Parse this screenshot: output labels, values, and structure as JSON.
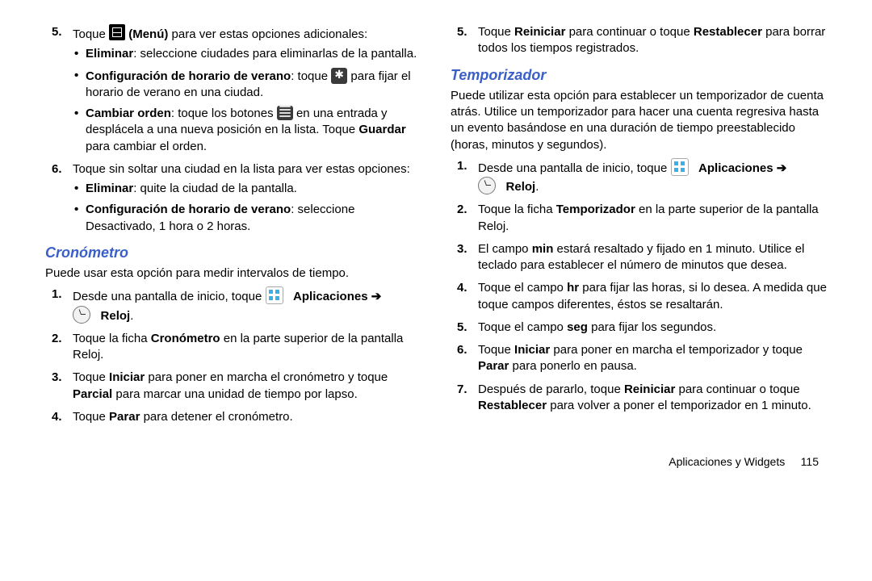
{
  "left": {
    "steps_a": [
      {
        "num": "5",
        "pre": "Toque ",
        "menu_label": "(Menú)",
        "post": " para ver estas opciones adicionales:",
        "bullets": [
          {
            "b": "Eliminar",
            "t": ": seleccione ciudades para eliminarlas de la pantalla."
          },
          {
            "b": "Configuración de horario de verano",
            "t1": ": toque ",
            "t2": " para fijar el horario de verano en una ciudad.",
            "dst_icon": true
          },
          {
            "b": "Cambiar orden",
            "t1": ": toque los botones ",
            "t2": " en una entrada y desplácela a una nueva posición en la lista. Toque ",
            "b2": "Guardar",
            "t3": " para cambiar el orden.",
            "handle_icon": true
          }
        ]
      },
      {
        "num": "6",
        "t1": "Toque sin soltar una ciudad en la lista para ver estas opciones:",
        "bullets": [
          {
            "b": "Eliminar",
            "t": ": quite la ciudad de la pantalla."
          },
          {
            "b": "Configuración de horario de verano",
            "t": ": seleccione Desactivado, 1 hora o 2 horas."
          }
        ]
      }
    ],
    "crono_title": "Cronómetro",
    "crono_intro": "Puede usar esta opción para medir intervalos de tiempo.",
    "crono_steps": [
      {
        "num": "1",
        "pre": "Desde una pantalla de inicio, toque ",
        "apps_label": "Aplicaciones",
        "arrow": " ➔ ",
        "clock_label": "Reloj",
        "suffix": "."
      },
      {
        "num": "2",
        "t1": "Toque la ficha ",
        "b1": "Cronómetro",
        "t2": " en la parte superior de la pantalla Reloj."
      },
      {
        "num": "3",
        "t1": "Toque ",
        "b1": "Iniciar",
        "t2": " para poner en marcha el cronómetro y toque ",
        "b2": "Parcial",
        "t3": " para marcar una unidad de tiempo por lapso."
      },
      {
        "num": "4",
        "t1": "Toque ",
        "b1": "Parar",
        "t2": " para detener el cronómetro."
      }
    ]
  },
  "right": {
    "top_step": {
      "num": "5",
      "t1": "Toque ",
      "b1": "Reiniciar",
      "t2": " para continuar o toque ",
      "b2": "Restablecer",
      "t3": " para borrar todos los tiempos registrados."
    },
    "temp_title": "Temporizador",
    "temp_intro": "Puede utilizar esta opción para establecer un temporizador de cuenta atrás. Utilice un temporizador para hacer una cuenta regresiva hasta un evento basándose en una duración de tiempo preestablecido (horas, minutos y segundos).",
    "temp_steps": [
      {
        "num": "1",
        "pre": "Desde una pantalla de inicio, toque ",
        "apps_label": "Aplicaciones",
        "arrow": " ➔ ",
        "clock_label": "Reloj",
        "suffix": "."
      },
      {
        "num": "2",
        "t1": "Toque la ficha ",
        "b1": "Temporizador",
        "t2": " en la parte superior de la pantalla Reloj."
      },
      {
        "num": "3",
        "t1": "El campo ",
        "b1": "min",
        "t2": " estará resaltado y fijado en 1 minuto. Utilice el teclado para establecer el número de minutos que desea."
      },
      {
        "num": "4",
        "t1": "Toque el campo ",
        "b1": "hr",
        "t2": " para fijar las horas, si lo desea. A medida que toque campos diferentes, éstos se resaltarán."
      },
      {
        "num": "5",
        "t1": "Toque el campo ",
        "b1": "seg",
        "t2": " para fijar los segundos."
      },
      {
        "num": "6",
        "t1": "Toque ",
        "b1": "Iniciar",
        "t2": " para poner en marcha el temporizador y toque ",
        "b2": "Parar",
        "t3": " para ponerlo en pausa."
      },
      {
        "num": "7",
        "t1": "Después de pararlo, toque ",
        "b1": "Reiniciar",
        "t2": " para continuar o toque ",
        "b2": "Restablecer",
        "t3": " para volver a poner el temporizador en 1 minuto."
      }
    ]
  },
  "footer_text": "Aplicaciones y Widgets",
  "footer_page": "115"
}
